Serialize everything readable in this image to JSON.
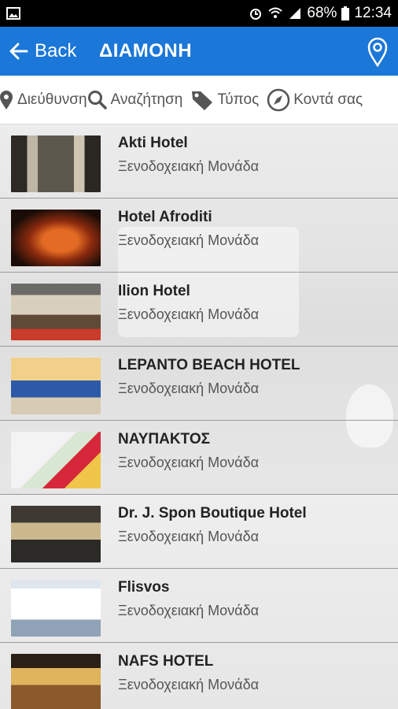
{
  "status": {
    "battery": "68%",
    "time": "12:34"
  },
  "header": {
    "back_label": "Back",
    "title": "ΔΙΑΜΟΝΗ"
  },
  "filters": [
    {
      "label": "Διεύθυνση",
      "icon": "location-pin-icon"
    },
    {
      "label": "Αναζήτηση",
      "icon": "search-icon"
    },
    {
      "label": "Τύπος",
      "icon": "tag-icon"
    },
    {
      "label": "Κοντά σας",
      "icon": "compass-icon"
    }
  ],
  "hotels": [
    {
      "name": "Akti Hotel",
      "type": "Ξενοδοχειακή Μονάδα"
    },
    {
      "name": "Hotel Afroditi",
      "type": "Ξενοδοχειακή Μονάδα"
    },
    {
      "name": "Ilion Hotel",
      "type": "Ξενοδοχειακή Μονάδα"
    },
    {
      "name": "LEPANTO BEACH HOTEL",
      "type": "Ξενοδοχειακή Μονάδα"
    },
    {
      "name": "ΝΑΥΠΑΚΤΟΣ",
      "type": "Ξενοδοχειακή Μονάδα"
    },
    {
      "name": "Dr. J. Spon Boutique Hotel",
      "type": "Ξενοδοχειακή Μονάδα"
    },
    {
      "name": "Flisvos",
      "type": "Ξενοδοχειακή Μονάδα"
    },
    {
      "name": "NAFS HOTEL",
      "type": "Ξενοδοχειακή Μονάδα"
    }
  ],
  "colors": {
    "appbar": "#1b77d8",
    "statusbar": "#000000"
  }
}
